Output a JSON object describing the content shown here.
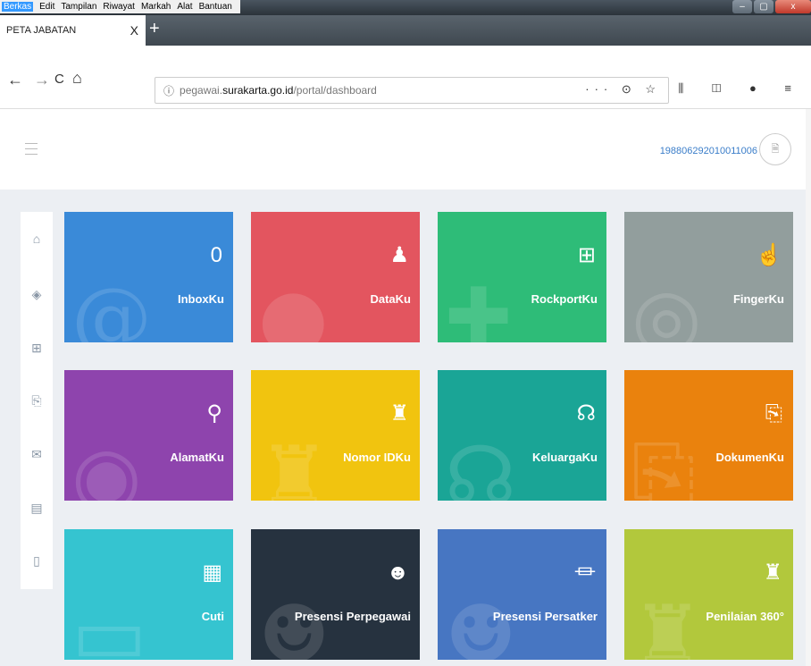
{
  "menubar": [
    "Berkas",
    "Edit",
    "Tampilan",
    "Riwayat",
    "Markah",
    "Alat",
    "Bantuan"
  ],
  "window_controls": {
    "minimize": "–",
    "maximize": "▢",
    "close": "x"
  },
  "tab": {
    "title": "PETA JABATAN",
    "close": "X",
    "new_tab": "+"
  },
  "nav": {
    "back": "←",
    "forward": "→",
    "reload": "C",
    "home": "⌂"
  },
  "url": {
    "prefix": "pegawai.",
    "domain": "surakarta.go.id",
    "path": "/portal/dashboard",
    "info_icon": "ⓘ",
    "actions": "··· ⊙ ☆"
  },
  "toolbar_icons": "⫼ ◫ ● ≡",
  "header": {
    "user_id": "198806292010011006",
    "avatar_icon": "🗎"
  },
  "sidenav": [
    {
      "icon": "home-icon",
      "glyph": "⌂"
    },
    {
      "icon": "layers-icon",
      "glyph": "◈"
    },
    {
      "icon": "briefcase-icon",
      "glyph": "⊞"
    },
    {
      "icon": "documents-icon",
      "glyph": "⎘"
    },
    {
      "icon": "mail-icon",
      "glyph": "✉"
    },
    {
      "icon": "book-icon",
      "glyph": "▤"
    },
    {
      "icon": "mobile-icon",
      "glyph": "▯"
    }
  ],
  "tiles": [
    {
      "label": "InboxKu",
      "icon": "inbox-icon",
      "glyph": "0",
      "bg": "@",
      "color": "#3a8ad8"
    },
    {
      "label": "DataKu",
      "icon": "user-icon",
      "glyph": "♟",
      "bg": "●",
      "color": "#e3555f"
    },
    {
      "label": "RockportKu",
      "icon": "plus-square-icon",
      "glyph": "⊞",
      "bg": "✚",
      "color": "#2ebc78"
    },
    {
      "label": "FingerKu",
      "icon": "hand-pointer-icon",
      "glyph": "☝",
      "bg": "◎",
      "color": "#929e9d"
    },
    {
      "label": "AlamatKu",
      "icon": "map-marker-icon",
      "glyph": "⚲",
      "bg": "◉",
      "color": "#8e44ad"
    },
    {
      "label": "Nomor IDKu",
      "icon": "id-icon",
      "glyph": "♜",
      "bg": "♜",
      "color": "#f1c40f"
    },
    {
      "label": "KeluargaKu",
      "icon": "family-icon",
      "glyph": "☊",
      "bg": "☊",
      "color": "#1aa596"
    },
    {
      "label": "DokumenKu",
      "icon": "files-icon",
      "glyph": "⎘",
      "bg": "⎘",
      "color": "#ea820d"
    },
    {
      "label": "Cuti",
      "icon": "calendar-icon",
      "glyph": "▦",
      "bg": "▭",
      "color": "#35c4d0"
    },
    {
      "label": "Presensi Perpegawai",
      "icon": "group-icon",
      "glyph": "☻",
      "bg": "☻",
      "color": "#26323f"
    },
    {
      "label": "Presensi Persatker",
      "icon": "bank-icon",
      "glyph": "⏛",
      "bg": "☻",
      "color": "#4776c2"
    },
    {
      "label": "Penilaian 360°",
      "icon": "award-icon",
      "glyph": "♜",
      "bg": "♜",
      "color": "#b2c83c"
    }
  ]
}
